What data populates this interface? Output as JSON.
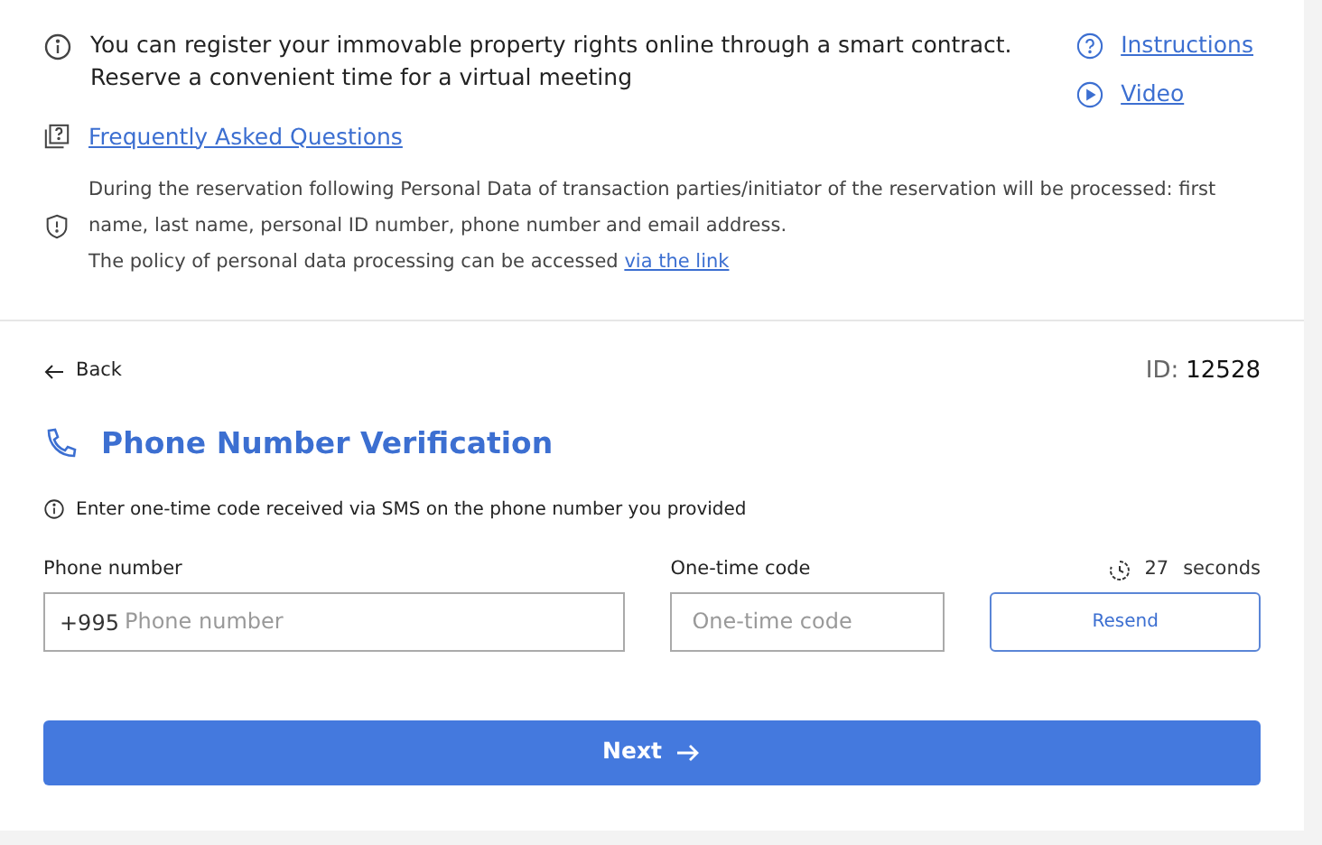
{
  "intro": {
    "lines": [
      "You can register your immovable property rights online through a smart contract.",
      "Reserve a convenient time for a virtual meeting"
    ]
  },
  "help_links": [
    {
      "label": "Instructions",
      "kind": "help"
    },
    {
      "label": "Video",
      "kind": "video"
    }
  ],
  "faq_link": "Frequently Asked Questions",
  "privacy": {
    "lines": [
      "During the reservation following Personal Data of transaction parties/initiator of the reservation will be processed: first",
      "name, last name, personal ID number, phone number and email address."
    ],
    "policy_text": "The policy of personal data processing can be accessed",
    "policy_link": "via the link"
  },
  "back": "Back",
  "id_label": "ID:",
  "id_value": "12528",
  "title": "Phone Number Verification",
  "note": "Enter one-time code received via SMS on the phone number you provided",
  "phone": {
    "label": "Phone number",
    "prefix": "+995",
    "placeholder": "Phone number"
  },
  "code": {
    "label": "One-time code",
    "placeholder": "One-time code"
  },
  "timer": {
    "value": "27",
    "unit": "seconds"
  },
  "resend": "Resend",
  "next": "Next"
}
